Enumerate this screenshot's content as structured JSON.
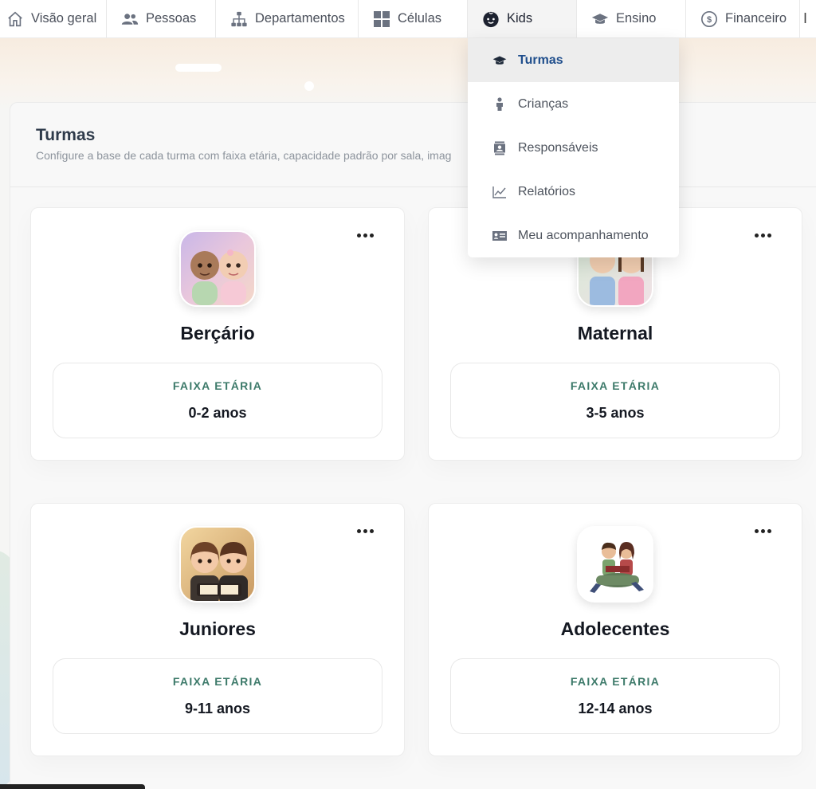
{
  "nav": {
    "items": [
      {
        "label": "Visão geral",
        "icon": "home-icon"
      },
      {
        "label": "Pessoas",
        "icon": "people-icon"
      },
      {
        "label": "Departamentos",
        "icon": "org-chart-icon"
      },
      {
        "label": "Células",
        "icon": "grid-icon"
      },
      {
        "label": "Kids",
        "icon": "baby-face-icon",
        "active": true
      },
      {
        "label": "Ensino",
        "icon": "graduation-cap-icon"
      },
      {
        "label": "Financeiro",
        "icon": "dollar-circle-icon"
      }
    ]
  },
  "dropdown": {
    "items": [
      {
        "label": "Turmas",
        "icon": "graduation-cap-icon",
        "selected": true
      },
      {
        "label": "Crianças",
        "icon": "child-icon"
      },
      {
        "label": "Responsáveis",
        "icon": "contact-book-icon"
      },
      {
        "label": "Relatórios",
        "icon": "line-chart-icon"
      },
      {
        "label": "Meu acompanhamento",
        "icon": "id-card-icon"
      }
    ]
  },
  "page": {
    "title": "Turmas",
    "subtitle": "Configure a base de cada turma com faixa etária, capacidade padrão por sala, imag"
  },
  "cards": [
    {
      "name": "Berçário",
      "age_label": "FAIXA ETÁRIA",
      "age_value": "0-2 anos"
    },
    {
      "name": "Maternal",
      "age_label": "FAIXA ETÁRIA",
      "age_value": "3-5 anos"
    },
    {
      "name": "Juniores",
      "age_label": "FAIXA ETÁRIA",
      "age_value": "9-11 anos"
    },
    {
      "name": "Adolecentes",
      "age_label": "FAIXA ETÁRIA",
      "age_value": "12-14 anos"
    }
  ],
  "colors": {
    "accent_link": "#1f4e8c",
    "age_label": "#3d7a6a"
  }
}
